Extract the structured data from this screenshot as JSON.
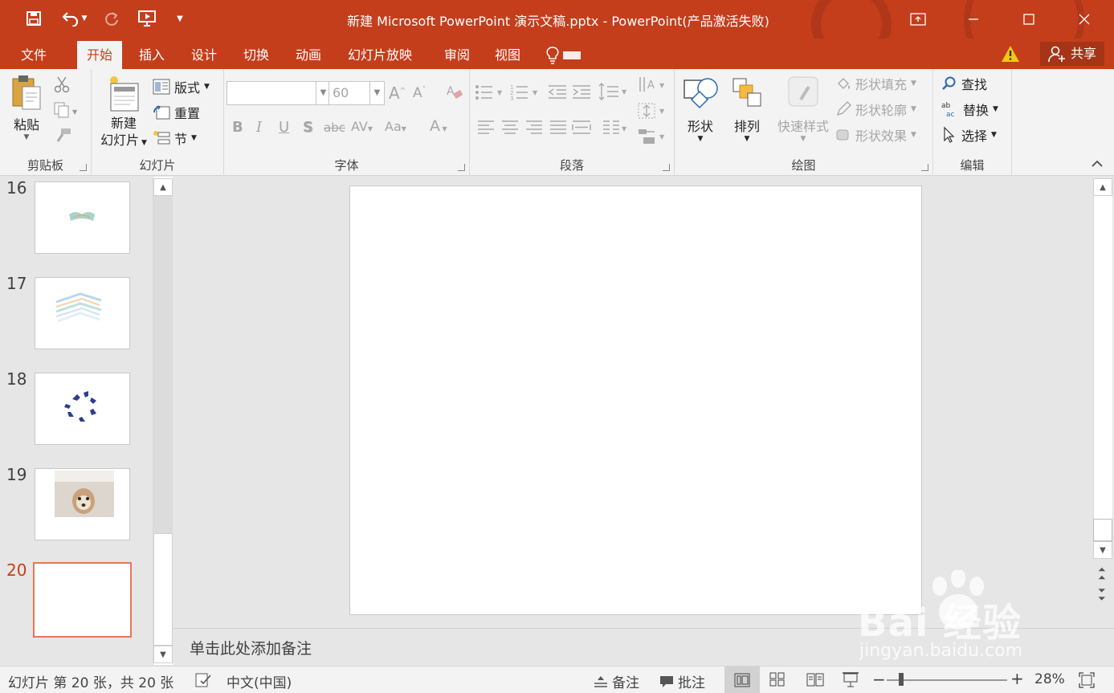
{
  "window": {
    "title": "新建 Microsoft PowerPoint 演示文稿.pptx - PowerPoint(产品激活失败)"
  },
  "quick_access": [
    {
      "name": "save-icon"
    },
    {
      "name": "undo-icon"
    },
    {
      "name": "redo-icon"
    },
    {
      "name": "start-from-beginning-icon"
    },
    {
      "name": "customize-qat-icon"
    }
  ],
  "tabs": [
    "文件",
    "开始",
    "插入",
    "设计",
    "切换",
    "动画",
    "幻灯片放映",
    "审阅",
    "视图"
  ],
  "active_tab": "开始",
  "share_label": "共享",
  "ribbon": {
    "clipboard": {
      "paste": "粘贴",
      "label": "剪贴板"
    },
    "slides": {
      "new_slide_line1": "新建",
      "new_slide_line2": "幻灯片",
      "layout": "版式",
      "reset": "重置",
      "section": "节",
      "label": "幻灯片"
    },
    "font": {
      "font_name": "",
      "font_size": "60",
      "label": "字体"
    },
    "paragraph": {
      "label": "段落"
    },
    "drawing": {
      "shapes": "形状",
      "arrange": "排列",
      "quick_styles": "快速样式",
      "shape_fill": "形状填充",
      "shape_outline": "形状轮廓",
      "shape_effects": "形状效果",
      "label": "绘图"
    },
    "editing": {
      "find": "查找",
      "replace": "替换",
      "select": "选择",
      "label": "编辑"
    }
  },
  "thumbnails": [
    {
      "number": "16"
    },
    {
      "number": "17"
    },
    {
      "number": "18"
    },
    {
      "number": "19"
    },
    {
      "number": "20",
      "selected": true
    }
  ],
  "notes_placeholder": "单击此处添加备注",
  "statusbar": {
    "slide_info": "幻灯片 第 20 张，共 20 张",
    "language": "中文(中国)",
    "notes": "备注",
    "comments": "批注",
    "zoom": "28%"
  },
  "watermark": {
    "brand": "Bai 经验",
    "url": "jingyan.baidu.com"
  },
  "colors": {
    "accent": "#c43e1c",
    "ribbon_bg": "#f3f3f3",
    "workspace_bg": "#e6e6e6",
    "selected_thumb_border": "#e9765b"
  }
}
